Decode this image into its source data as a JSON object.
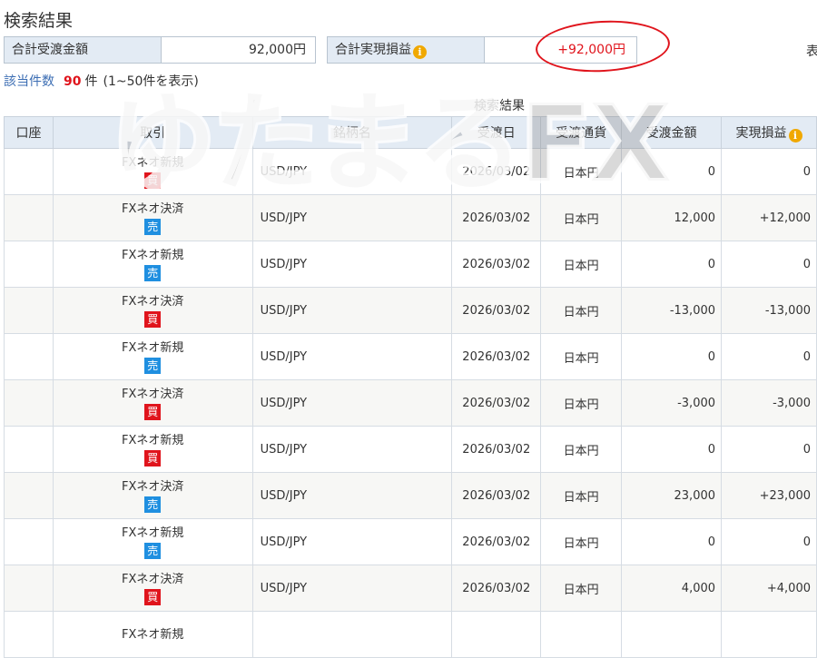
{
  "page": {
    "title": "検索結果",
    "summary": {
      "total_delivery_label": "合計受渡金額",
      "total_delivery_value": "92,000円",
      "total_pnl_label": "合計実現損益",
      "total_pnl_value": "+92,000円",
      "cut_text": "表"
    },
    "count": {
      "label": "該当件数",
      "value": "90",
      "unit": "件",
      "range": "(1~50件を表示)"
    },
    "table_caption": "検索結果",
    "watermark": "ゆたまるFX"
  },
  "table": {
    "headers": [
      "口座",
      "取引",
      "銘柄名",
      "受渡日",
      "受渡通貨",
      "受渡金額",
      "実現損益"
    ],
    "rows": [
      {
        "account": "",
        "trade": "FXネオ新規",
        "side": "買",
        "symbol": "USD/JPY",
        "date": "2026/03/02",
        "currency": "日本円",
        "amount": "0",
        "pnl": "0"
      },
      {
        "account": "",
        "trade": "FXネオ決済",
        "side": "売",
        "symbol": "USD/JPY",
        "date": "2026/03/02",
        "currency": "日本円",
        "amount": "12,000",
        "pnl": "+12,000"
      },
      {
        "account": "",
        "trade": "FXネオ新規",
        "side": "売",
        "symbol": "USD/JPY",
        "date": "2026/03/02",
        "currency": "日本円",
        "amount": "0",
        "pnl": "0"
      },
      {
        "account": "",
        "trade": "FXネオ決済",
        "side": "買",
        "symbol": "USD/JPY",
        "date": "2026/03/02",
        "currency": "日本円",
        "amount": "-13,000",
        "pnl": "-13,000"
      },
      {
        "account": "",
        "trade": "FXネオ新規",
        "side": "売",
        "symbol": "USD/JPY",
        "date": "2026/03/02",
        "currency": "日本円",
        "amount": "0",
        "pnl": "0"
      },
      {
        "account": "",
        "trade": "FXネオ決済",
        "side": "買",
        "symbol": "USD/JPY",
        "date": "2026/03/02",
        "currency": "日本円",
        "amount": "-3,000",
        "pnl": "-3,000"
      },
      {
        "account": "",
        "trade": "FXネオ新規",
        "side": "買",
        "symbol": "USD/JPY",
        "date": "2026/03/02",
        "currency": "日本円",
        "amount": "0",
        "pnl": "0"
      },
      {
        "account": "",
        "trade": "FXネオ決済",
        "side": "売",
        "symbol": "USD/JPY",
        "date": "2026/03/02",
        "currency": "日本円",
        "amount": "23,000",
        "pnl": "+23,000"
      },
      {
        "account": "",
        "trade": "FXネオ新規",
        "side": "売",
        "symbol": "USD/JPY",
        "date": "2026/03/02",
        "currency": "日本円",
        "amount": "0",
        "pnl": "0"
      },
      {
        "account": "",
        "trade": "FXネオ決済",
        "side": "買",
        "symbol": "USD/JPY",
        "date": "2026/03/02",
        "currency": "日本円",
        "amount": "4,000",
        "pnl": "+4,000"
      },
      {
        "account": "",
        "trade": "FXネオ新規",
        "side": "",
        "symbol": "",
        "date": "",
        "currency": "",
        "amount": "",
        "pnl": ""
      }
    ]
  },
  "colors": {
    "header_bg": "#e3ebf4",
    "positive": "#e0141c",
    "negative": "#2b6cb8",
    "buy_badge": "#e0141c",
    "sell_badge": "#1f8fe0",
    "link": "#3b6db3",
    "annotation_circle": "#e0141c"
  },
  "icons": {
    "info": "info-icon"
  }
}
